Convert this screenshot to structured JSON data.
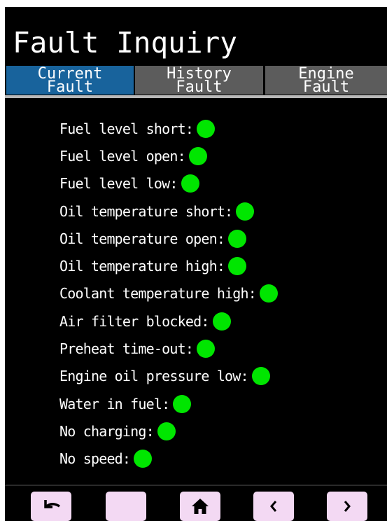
{
  "header": {
    "title": "Fault Inquiry"
  },
  "tabs": [
    {
      "line1": "Current",
      "line2": "Fault",
      "active": true
    },
    {
      "line1": "History",
      "line2": "Fault",
      "active": false
    },
    {
      "line1": "Engine",
      "line2": "Fault",
      "active": false
    }
  ],
  "faults": [
    {
      "label": "Fuel level short:",
      "status": "ok"
    },
    {
      "label": "Fuel level open:",
      "status": "ok"
    },
    {
      "label": "Fuel level low:",
      "status": "ok"
    },
    {
      "label": "Oil temperature short:",
      "status": "ok"
    },
    {
      "label": "Oil temperature open:",
      "status": "ok"
    },
    {
      "label": "Oil temperature high:",
      "status": "ok"
    },
    {
      "label": "Coolant temperature high:",
      "status": "ok"
    },
    {
      "label": "Air filter blocked:",
      "status": "ok"
    },
    {
      "label": "Preheat time-out:",
      "status": "ok"
    },
    {
      "label": "Engine oil pressure low:",
      "status": "ok"
    },
    {
      "label": "Water in fuel:",
      "status": "ok"
    },
    {
      "label": "No charging:",
      "status": "ok"
    },
    {
      "label": "No speed:",
      "status": "ok"
    }
  ],
  "bottom_nav": [
    {
      "icon": "back-arrow-icon"
    },
    {
      "icon": ""
    },
    {
      "icon": "home-icon"
    },
    {
      "icon": "chevron-left-icon"
    },
    {
      "icon": "chevron-right-icon"
    }
  ],
  "colors": {
    "background": "#000000",
    "tab_active": "#18639c",
    "tab_inactive": "#5c5c5c",
    "indicator_ok": "#00e600",
    "button_face": "#f3d9f3",
    "text": "#ffffff"
  }
}
